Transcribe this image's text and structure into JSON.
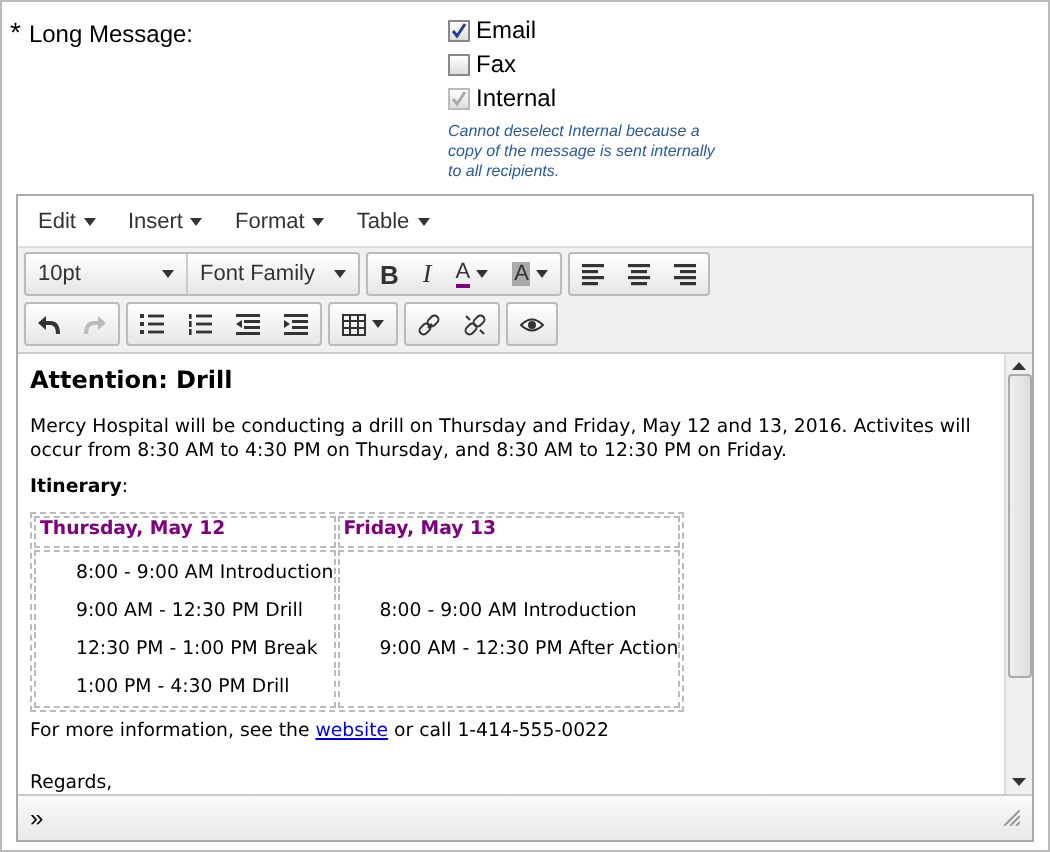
{
  "field": {
    "required_mark": "*",
    "label": "Long Message:"
  },
  "options": [
    {
      "label": "Email",
      "checked": true,
      "disabled": false
    },
    {
      "label": "Fax",
      "checked": false,
      "disabled": false
    },
    {
      "label": "Internal",
      "checked": true,
      "disabled": true
    }
  ],
  "hint": "Cannot deselect Internal because a copy of the message is sent internally to all recipients.",
  "editor": {
    "menus": [
      "Edit",
      "Insert",
      "Format",
      "Table"
    ],
    "toolbar": {
      "font_size": "10pt",
      "font_family": "Font Family",
      "bold": "B",
      "italic": "I",
      "text_color": "A",
      "background_color": "A",
      "redo_disabled": true
    },
    "heading": "Attention: Drill",
    "paragraph": "Mercy Hospital will be conducting a drill on Thursday and Friday, May 12 and 13, 2016. Activites will occur from 8:30 AM to 4:30 PM on Thursday, and 8:30 AM to 12:30 PM on Friday.",
    "itinerary_label": "**Itinerary**:",
    "table": {
      "columns": [
        "Thursday, May 12",
        "Friday, May 13"
      ],
      "rows": [
        {
          "column_1": "8:00 - 9:00 AM Introduction"
        },
        {
          "column_1": "9:00 AM - 12:30 PM Drill",
          "column_2": "8:00 - 9:00 AM Introduction"
        },
        {
          "column_1": "12:30 PM - 1:00 PM Break",
          "column_2": "9:00 AM - 12:30 PM After Action"
        },
        {
          "column_1": "1:00 PM - 4:30 PM Drill"
        }
      ]
    },
    "info": {
      "before": "For more information, see the",
      "link": "website",
      "after": "or call 1-414-555-0022"
    },
    "closing": "Regards,",
    "status_bar": "»"
  }
}
